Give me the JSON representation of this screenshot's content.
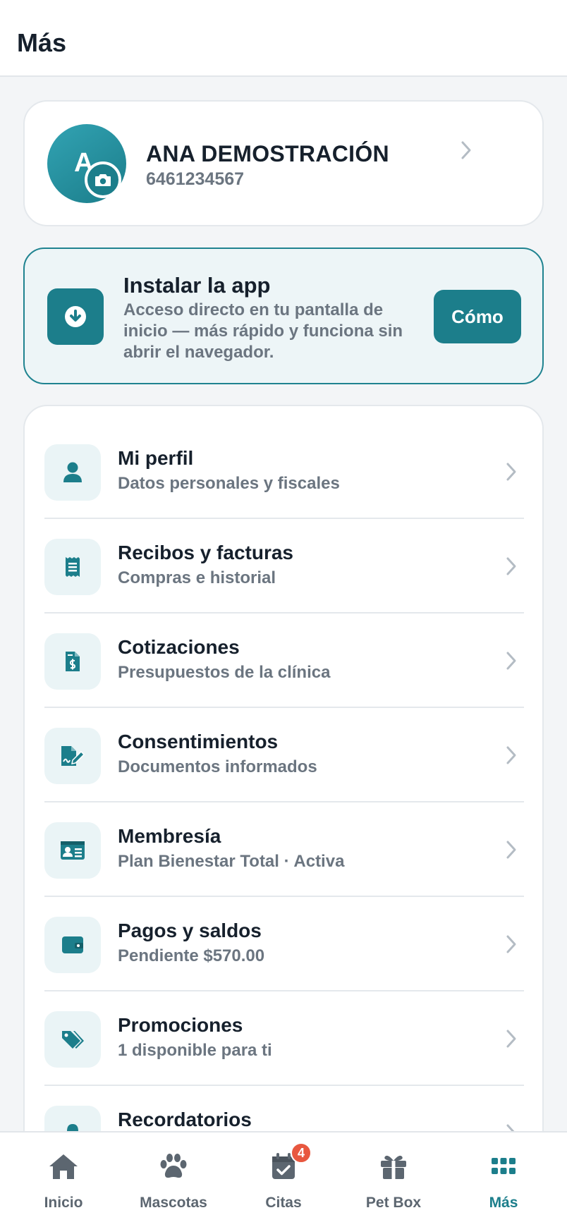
{
  "header": {
    "title": "Más"
  },
  "profile": {
    "avatar_letter": "A",
    "name": "ANA DEMOSTRACIÓN",
    "phone": "6461234567"
  },
  "install": {
    "title": "Instalar la app",
    "description": "Acceso directo en tu pantalla de inicio — más rápido y funciona sin abrir el navegador.",
    "button_label": "Cómo"
  },
  "menu": {
    "items": [
      {
        "icon": "person-icon",
        "label": "Mi perfil",
        "sub": "Datos personales y fiscales"
      },
      {
        "icon": "receipt-icon",
        "label": "Recibos y facturas",
        "sub": "Compras e historial"
      },
      {
        "icon": "invoice-dollar-icon",
        "label": "Cotizaciones",
        "sub": "Presupuestos de la clínica"
      },
      {
        "icon": "signature-file-icon",
        "label": "Consentimientos",
        "sub": "Documentos informados"
      },
      {
        "icon": "id-card-icon",
        "label": "Membresía",
        "sub": "Plan Bienestar Total · Activa"
      },
      {
        "icon": "wallet-icon",
        "label": "Pagos y saldos",
        "sub": "Pendiente $570.00"
      },
      {
        "icon": "tags-icon",
        "label": "Promociones",
        "sub": "1 disponible para ti"
      },
      {
        "icon": "bell-icon",
        "label": "Recordatorios",
        "sub": ""
      }
    ]
  },
  "nav": {
    "items": [
      {
        "icon": "home-icon",
        "label": "Inicio"
      },
      {
        "icon": "paw-icon",
        "label": "Mascotas"
      },
      {
        "icon": "calendar-check-icon",
        "label": "Citas",
        "badge": "4"
      },
      {
        "icon": "gift-icon",
        "label": "Pet Box"
      },
      {
        "icon": "grid-icon",
        "label": "Más"
      }
    ],
    "active": "Más"
  },
  "colors": {
    "accent": "#1c7e8b",
    "icon_bg": "#eaf4f6",
    "badge": "#e8573f",
    "text": "#16202c",
    "muted": "#6b7580"
  }
}
